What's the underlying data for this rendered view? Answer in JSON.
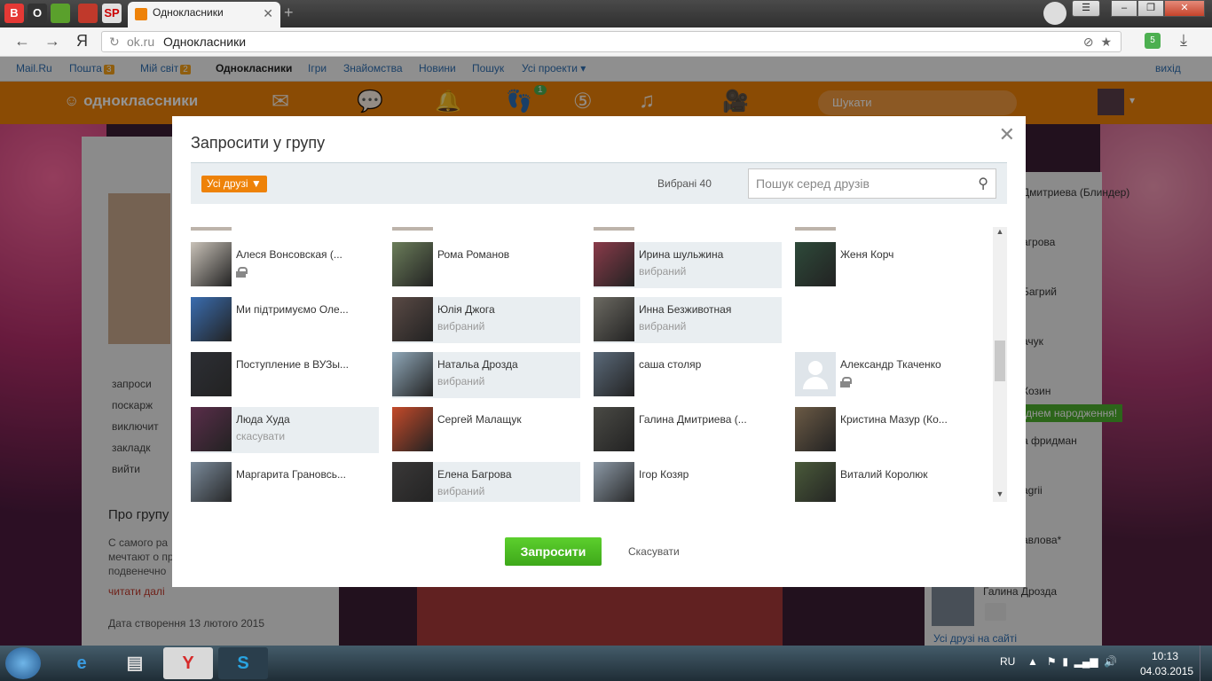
{
  "browser": {
    "pinned": [
      {
        "label": "B",
        "bg": "#e53935",
        "fg": "#fff"
      },
      {
        "label": "O",
        "bg": "#333333",
        "fg": "#fff"
      },
      {
        "label": "",
        "bg": "#5aa02c",
        "fg": "#fff"
      },
      {
        "label": "",
        "bg": "#c0392b",
        "fg": "#fff"
      },
      {
        "label": "SP",
        "bg": "#e0e0e0",
        "fg": "#c00"
      }
    ],
    "active_tab": "Однокласники",
    "new_tab_icon": "plus-icon",
    "address_domain": "ok.ru",
    "address_title": "Однокласники",
    "yandex_logo": "Я",
    "extension_badge": "5"
  },
  "portal": {
    "mail": "Mail.Ru",
    "inbox": "Пошта",
    "inbox_count": "3",
    "myworld": "Мій світ",
    "myworld_count": "2",
    "ok": "Однокласники",
    "games": "Ігри",
    "dating": "Знайомства",
    "news": "Новини",
    "search": "Пошук",
    "all_projects": "Усі проекти",
    "logout": "вихід"
  },
  "ok_header": {
    "logo": "одноклассники",
    "search_placeholder": "Шукати",
    "notif_badge": "1"
  },
  "page": {
    "left_menu": [
      "запроси",
      "поскарж",
      "виключит",
      "закладк",
      "вийти"
    ],
    "about_title": "Про групу",
    "about_text": [
      "С самого ра",
      "мечтают о пр",
      "подвенечно"
    ],
    "read_more": "читати далі",
    "created": "Дата створення 13 лютого 2015",
    "right_friends": [
      "Дмитриева (Блиндер)",
      "агрова",
      "Багрий",
      "ачук",
      "Козин",
      "а фридман",
      "agrii",
      "авлова*"
    ],
    "birthday": "днем народження!",
    "right_friend_name": "Галина Дрозда",
    "all_friends": "Усі друзі на сайті"
  },
  "modal": {
    "title": "Запросити у групу",
    "filter_label": "Усі друзі",
    "selected": "Вибрані 40",
    "search_placeholder": "Пошук серед друзів",
    "invite": "Запросити",
    "cancel": "Скасувати",
    "friends": [
      {
        "name": "Алеся Вонсовская (...",
        "status": "",
        "locked": true,
        "selected": false,
        "col": 0,
        "row": 0,
        "color": "#c9c2b8"
      },
      {
        "name": "Рома Романов",
        "status": "",
        "locked": false,
        "selected": false,
        "col": 1,
        "row": 0,
        "color": "#6b7d5a"
      },
      {
        "name": "Ирина шульжина",
        "status": "вибраний",
        "locked": false,
        "selected": true,
        "col": 2,
        "row": 0,
        "color": "#8a3b4a"
      },
      {
        "name": "Женя Корч",
        "status": "",
        "locked": false,
        "selected": false,
        "col": 3,
        "row": 0,
        "color": "#2e4a3a"
      },
      {
        "name": "Ми підтримуємо Оле...",
        "status": "",
        "locked": false,
        "selected": false,
        "col": 0,
        "row": 1,
        "color": "#3a6db0"
      },
      {
        "name": "Юлія Джога",
        "status": "вибраний",
        "locked": false,
        "selected": true,
        "col": 1,
        "row": 1,
        "color": "#5a4a45"
      },
      {
        "name": "Инна Безживотная",
        "status": "вибраний",
        "locked": false,
        "selected": true,
        "col": 2,
        "row": 1,
        "color": "#6c6a62"
      },
      {
        "name": "Поступление в ВУЗы...",
        "status": "",
        "locked": false,
        "selected": false,
        "col": 0,
        "row": 2,
        "color": "#2d2f35"
      },
      {
        "name": "Натальа Дрозда",
        "status": "вибраний",
        "locked": false,
        "selected": true,
        "col": 1,
        "row": 2,
        "color": "#8fa7b8"
      },
      {
        "name": "саша столяр",
        "status": "",
        "locked": false,
        "selected": false,
        "col": 2,
        "row": 2,
        "color": "#5b6a7a"
      },
      {
        "name": "Александр Ткаченко",
        "status": "",
        "locked": true,
        "selected": false,
        "col": 3,
        "row": 2,
        "color": "#dfe5ea"
      },
      {
        "name": "Люда Худа",
        "status": "скасувати",
        "locked": false,
        "selected": true,
        "col": 0,
        "row": 3,
        "color": "#5a2d4a"
      },
      {
        "name": "Сергей Малащук",
        "status": "",
        "locked": false,
        "selected": false,
        "col": 1,
        "row": 3,
        "color": "#c44a2a"
      },
      {
        "name": "Галина Дмитриева (...",
        "status": "",
        "locked": false,
        "selected": false,
        "col": 2,
        "row": 3,
        "color": "#4a4a45"
      },
      {
        "name": "Кристина Мазур (Ко...",
        "status": "",
        "locked": false,
        "selected": false,
        "col": 3,
        "row": 3,
        "color": "#6b5a45"
      },
      {
        "name": "Маргарита Грановсь...",
        "status": "",
        "locked": false,
        "selected": false,
        "col": 0,
        "row": 4,
        "color": "#7a8a9a"
      },
      {
        "name": "Елена Багрова",
        "status": "вибраний",
        "locked": false,
        "selected": true,
        "col": 1,
        "row": 4,
        "color": "#3a3838"
      },
      {
        "name": "Ігор Козяр",
        "status": "",
        "locked": false,
        "selected": false,
        "col": 2,
        "row": 4,
        "color": "#8c99a6"
      },
      {
        "name": "Виталий Королюк",
        "status": "",
        "locked": false,
        "selected": false,
        "col": 3,
        "row": 4,
        "color": "#4a5a3a"
      }
    ]
  },
  "taskbar": {
    "lang": "RU",
    "time": "10:13",
    "date": "04.03.2015",
    "apps": [
      {
        "icon": "ie-icon",
        "glyph": "e",
        "bg": "transparent"
      },
      {
        "icon": "files-icon",
        "glyph": "▤",
        "bg": "transparent"
      },
      {
        "icon": "yandex-browser-icon",
        "glyph": "Y",
        "bg": "#d9d9d9"
      },
      {
        "icon": "skype-icon",
        "glyph": "S",
        "bg": "#2a3e4c"
      }
    ]
  }
}
